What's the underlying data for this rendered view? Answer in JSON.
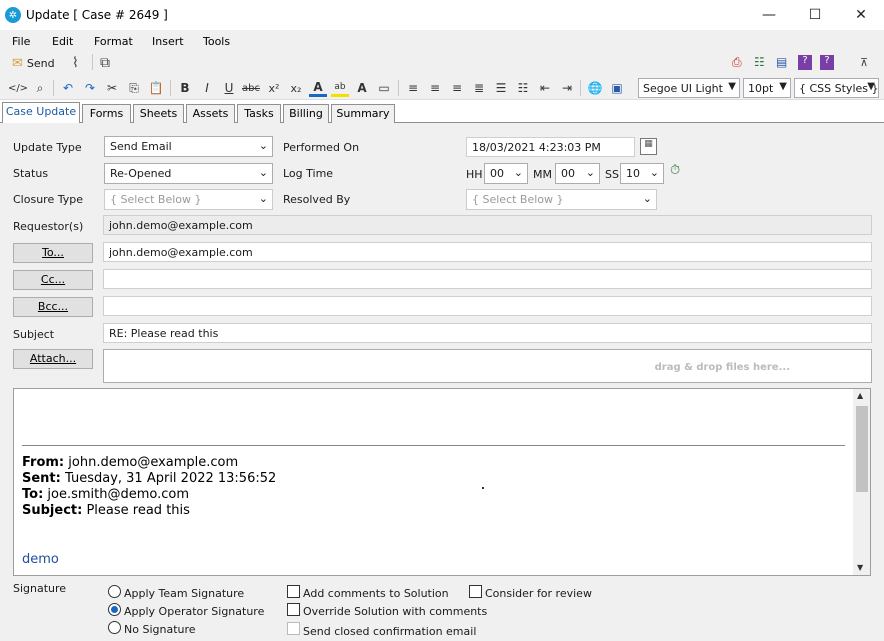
{
  "window": {
    "title": "Update [ Case # 2649 ]"
  },
  "menu": [
    "File",
    "Edit",
    "Format",
    "Insert",
    "Tools"
  ],
  "toolbar": {
    "send_label": "Send",
    "font_name": "Segoe UI Light",
    "font_size": "10pt",
    "css_styles": "{ CSS Styles }"
  },
  "tabs": [
    "Case Update",
    "Forms",
    "Sheets",
    "Assets",
    "Tasks",
    "Billing",
    "Summary"
  ],
  "form": {
    "update_type": {
      "label": "Update Type",
      "value": "Send Email"
    },
    "status": {
      "label": "Status",
      "value": "Re-Opened"
    },
    "closure_type": {
      "label": "Closure Type",
      "value": "{ Select Below }"
    },
    "performed_on": {
      "label": "Performed On",
      "value": "18/03/2021 4:23:03 PM"
    },
    "log_time": {
      "label": "Log Time",
      "hh_label": "HH",
      "hh": "00",
      "mm_label": "MM",
      "mm": "00",
      "ss_label": "SS",
      "ss": "10"
    },
    "resolved_by": {
      "label": "Resolved By",
      "value": "{ Select Below }"
    },
    "requestors": {
      "label": "Requestor(s)",
      "value": "john.demo@example.com"
    },
    "to": {
      "button": "To...",
      "value": "john.demo@example.com"
    },
    "cc": {
      "button": "Cc...",
      "value": ""
    },
    "bcc": {
      "button": "Bcc...",
      "value": ""
    },
    "subject": {
      "label": "Subject",
      "value": "RE: Please read this"
    },
    "attach": {
      "button": "Attach...",
      "drop_hint": "drag & drop files here..."
    }
  },
  "email_body": {
    "from_label": "From:",
    "from": "john.demo@example.com",
    "sent_label": "Sent:",
    "sent": "Tuesday, 31 April 2022 13:56:52",
    "to_label": "To:",
    "to": "joe.smith@demo.com",
    "subject_label": "Subject:",
    "subject": "Please read this",
    "body": "demo"
  },
  "signature": {
    "label": "Signature",
    "options": [
      "Apply Team Signature",
      "Apply Operator Signature",
      "No Signature"
    ],
    "selected": "Apply Operator Signature"
  },
  "options": {
    "add_comments": "Add comments to Solution",
    "override_solution": "Override Solution with comments",
    "send_closed": "Send closed confirmation email",
    "consider_review": "Consider for review"
  },
  "colors": {
    "accent": "#1a66c4",
    "tab_active_text": "#1d5aa7",
    "body_link": "#1f4e9c"
  }
}
